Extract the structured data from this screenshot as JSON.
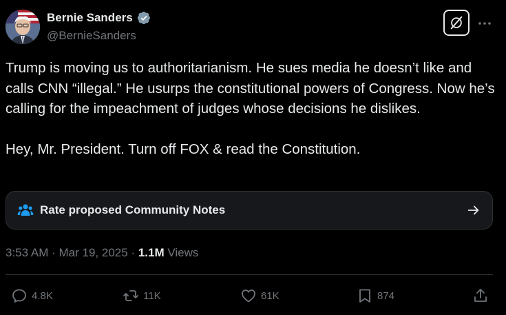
{
  "user": {
    "name": "Bernie Sanders",
    "handle": "@BernieSanders",
    "verified": true
  },
  "tweet": {
    "text": "Trump is moving us to authoritarianism.  He sues media he doesn’t like and calls CNN “illegal.” He usurps the constitutional powers of Congress. Now he’s calling for the impeachment of judges whose decisions he dislikes.\n\nHey, Mr. President. Turn off FOX & read the Constitution."
  },
  "community_notes": {
    "label": "Rate proposed Community Notes"
  },
  "meta": {
    "time": "3:53 AM",
    "separator": "·",
    "date": "Mar 19, 2025",
    "views_count": "1.1M",
    "views_label": "Views"
  },
  "actions": {
    "replies": "4.8K",
    "reposts": "11K",
    "likes": "61K",
    "bookmarks": "874"
  },
  "colors": {
    "background": "#000000",
    "text": "#e7e9ea",
    "secondary_text": "#71767b",
    "verified_badge": "#829aab",
    "notes_icon": "#1d9bf0",
    "notes_background": "#16181c"
  }
}
